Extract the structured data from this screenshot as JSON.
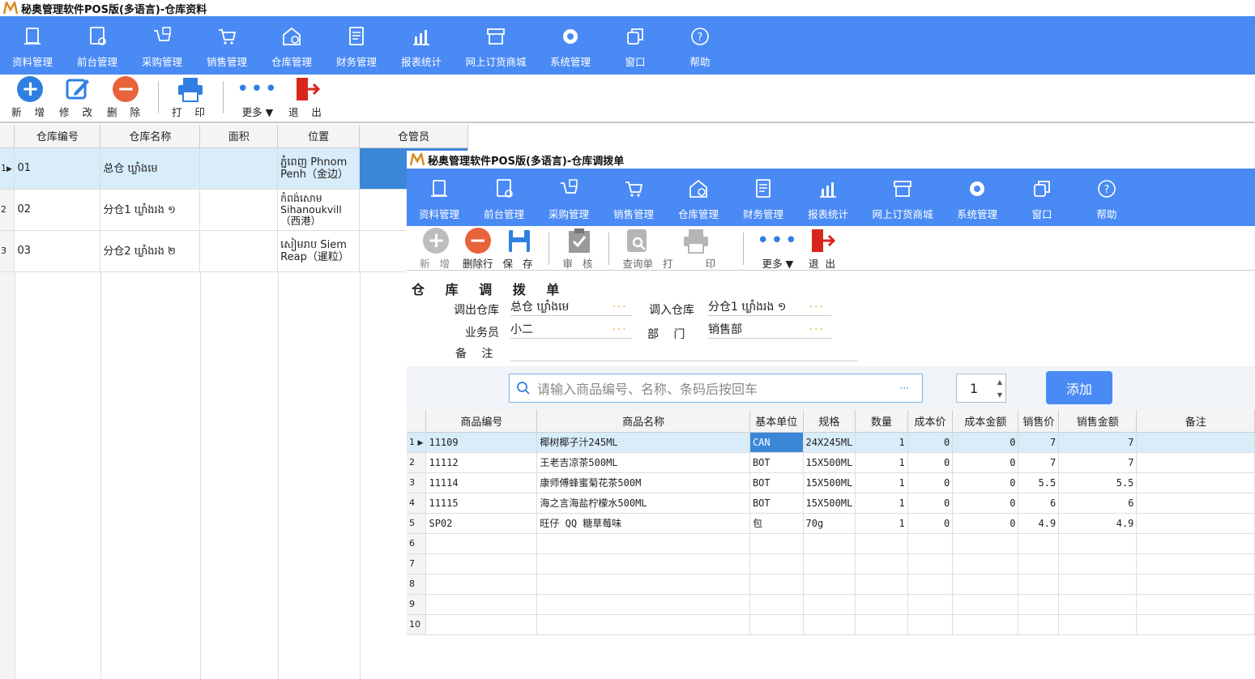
{
  "app": {
    "title": "秘奥管理软件POS版(多语言)-仓库资料"
  },
  "ribbon": [
    {
      "label": "资料管理",
      "icon": "document-icon"
    },
    {
      "label": "前台管理",
      "icon": "register-icon"
    },
    {
      "label": "采购管理",
      "icon": "cart-check-icon"
    },
    {
      "label": "销售管理",
      "icon": "cart-icon"
    },
    {
      "label": "仓库管理",
      "icon": "warehouse-icon"
    },
    {
      "label": "财务管理",
      "icon": "ledger-icon"
    },
    {
      "label": "报表统计",
      "icon": "chart-icon"
    },
    {
      "label": "网上订货商城",
      "icon": "shop-icon"
    },
    {
      "label": "系统管理",
      "icon": "gear-icon"
    },
    {
      "label": "窗口",
      "icon": "windows-icon"
    },
    {
      "label": "帮助",
      "icon": "help-icon"
    }
  ],
  "toolbar": {
    "add": "新 增",
    "edit": "修 改",
    "delete": "删 除",
    "print": "打 印",
    "more": "更多",
    "exit": "退 出"
  },
  "warehouse_grid": {
    "headers": [
      "仓库编号",
      "仓库名称",
      "面积",
      "位置",
      "仓管员"
    ],
    "rows": [
      {
        "n": "1",
        "code": "01",
        "name": "总仓 ឃ្លាំងមេ",
        "area": "",
        "loc1": "ភ្នំពេញ Phnom",
        "loc2": "Penh（金边）",
        "mgr": ""
      },
      {
        "n": "2",
        "code": "02",
        "name": "分仓1 ឃ្លាំងរង ១",
        "area": "",
        "loc1": "កំពង់សោម",
        "loc2": "Sihanoukvill",
        "loc3": "（西港）",
        "mgr": ""
      },
      {
        "n": "3",
        "code": "03",
        "name": "分仓2 ឃ្លាំងរង ២",
        "area": "",
        "loc1": "សៀមរាប Siem",
        "loc2": "Reap（暹粒）",
        "mgr": ""
      }
    ]
  },
  "transfer_window": {
    "title": "秘奥管理软件POS版(多语言)-仓库调拨单",
    "toolbar": {
      "add": "新 增",
      "delete_row": "删除行",
      "save": "保 存",
      "audit": "审 核",
      "query": "查询单",
      "print": "打 印",
      "more": "更多",
      "exit": "退 出"
    },
    "form_title": "仓 库 调 拨 单",
    "form": {
      "out_label": "调出仓库",
      "out_value": "总仓 ឃ្លាំងមេ",
      "in_label": "调入仓库",
      "in_value": "分仓1 ឃ្លាំងរង ១",
      "staff_label": "业务员",
      "staff_value": "小二",
      "dept_label": "部　 门",
      "dept_value": "销售部",
      "note_label": "备　 注",
      "note_value": ""
    },
    "search": {
      "placeholder": "请输入商品编号、名称、条码后按回车",
      "quantity": "1",
      "add_button": "添加"
    },
    "grid": {
      "headers": [
        "商品编号",
        "商品名称",
        "基本单位",
        "规格",
        "数量",
        "成本价",
        "成本金额",
        "销售价",
        "销售金额",
        "备注"
      ],
      "rows": [
        {
          "n": "1",
          "cells": [
            "11109",
            "椰树椰子汁245ML",
            "CAN",
            "24X245ML",
            "1",
            "0",
            "0",
            "7",
            "7",
            ""
          ]
        },
        {
          "n": "2",
          "cells": [
            "11112",
            "王老吉凉茶500ML",
            "BOT",
            "15X500ML",
            "1",
            "0",
            "0",
            "7",
            "7",
            ""
          ]
        },
        {
          "n": "3",
          "cells": [
            "11114",
            "康师傅蜂蜜菊花茶500M",
            "BOT",
            "15X500ML",
            "1",
            "0",
            "0",
            "5.5",
            "5.5",
            ""
          ]
        },
        {
          "n": "4",
          "cells": [
            "11115",
            "海之言海盐柠檬水500ML",
            "BOT",
            "15X500ML",
            "1",
            "0",
            "0",
            "6",
            "6",
            ""
          ]
        },
        {
          "n": "5",
          "cells": [
            "SP02",
            "旺仔 QQ 糖草莓味",
            "包",
            "70g",
            "1",
            "0",
            "0",
            "4.9",
            "4.9",
            ""
          ]
        },
        {
          "n": "6",
          "cells": [
            "",
            "",
            "",
            "",
            "",
            "",
            "",
            "",
            "",
            ""
          ]
        },
        {
          "n": "7",
          "cells": [
            "",
            "",
            "",
            "",
            "",
            "",
            "",
            "",
            "",
            ""
          ]
        },
        {
          "n": "8",
          "cells": [
            "",
            "",
            "",
            "",
            "",
            "",
            "",
            "",
            "",
            ""
          ]
        },
        {
          "n": "9",
          "cells": [
            "",
            "",
            "",
            "",
            "",
            "",
            "",
            "",
            "",
            ""
          ]
        },
        {
          "n": "10",
          "cells": [
            "",
            "",
            "",
            "",
            "",
            "",
            "",
            "",
            "",
            ""
          ]
        }
      ]
    }
  },
  "colors": {
    "ribbon": "#4a8af4",
    "selected_row": "#d8ecfa",
    "highlight_cell": "#3c86d8"
  }
}
